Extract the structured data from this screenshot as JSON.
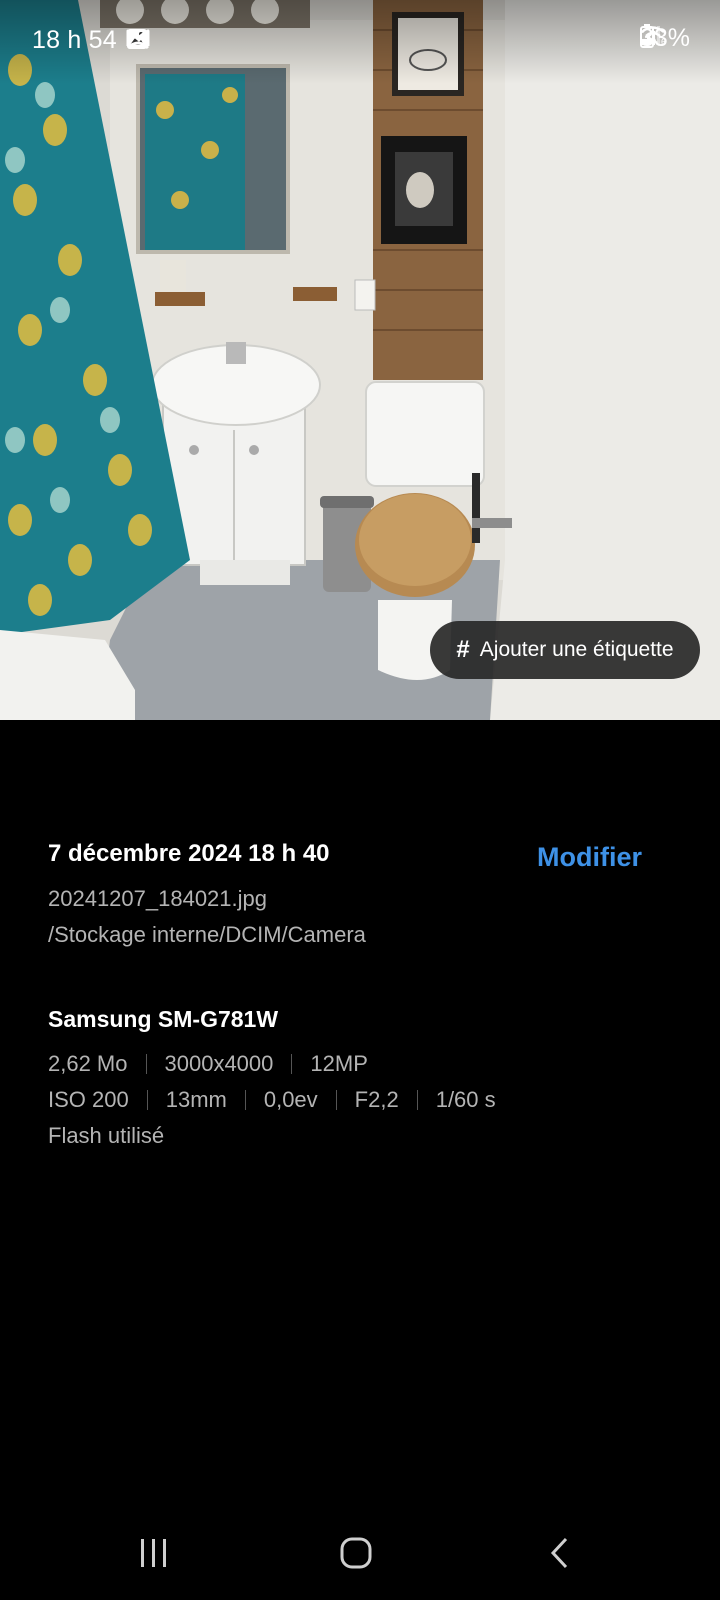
{
  "status_bar": {
    "time": "18 h 54",
    "battery": "33%",
    "icons_left": [
      "gallery-icon",
      "gmail-icon",
      "missed-call-icon",
      "dot-icon"
    ],
    "icons_right": [
      "wifi-icon",
      "signal-icon",
      "battery-icon"
    ]
  },
  "photo": {
    "tag_button_label": "Ajouter une étiquette",
    "tag_button_icon": "hash-icon"
  },
  "details": {
    "date": "7 décembre 2024 18 h 40",
    "edit_label": "Modifier",
    "filename": "20241207_184021.jpg",
    "path": "/Stockage interne/DCIM/Camera",
    "device": "Samsung SM-G781W",
    "size": "2,62 Mo",
    "resolution": "3000x4000",
    "megapixels": "12MP",
    "iso": "ISO 200",
    "focal_length": "13mm",
    "exposure_value": "0,0ev",
    "aperture": "F2,2",
    "shutter": "1/60 s",
    "flash": "Flash utilisé"
  },
  "nav_bar": {
    "buttons": [
      "recent-apps-icon",
      "home-icon",
      "back-icon"
    ]
  },
  "colors": {
    "accent": "#3e91e6",
    "background": "#000000",
    "secondary_text": "#b4b4b4"
  }
}
